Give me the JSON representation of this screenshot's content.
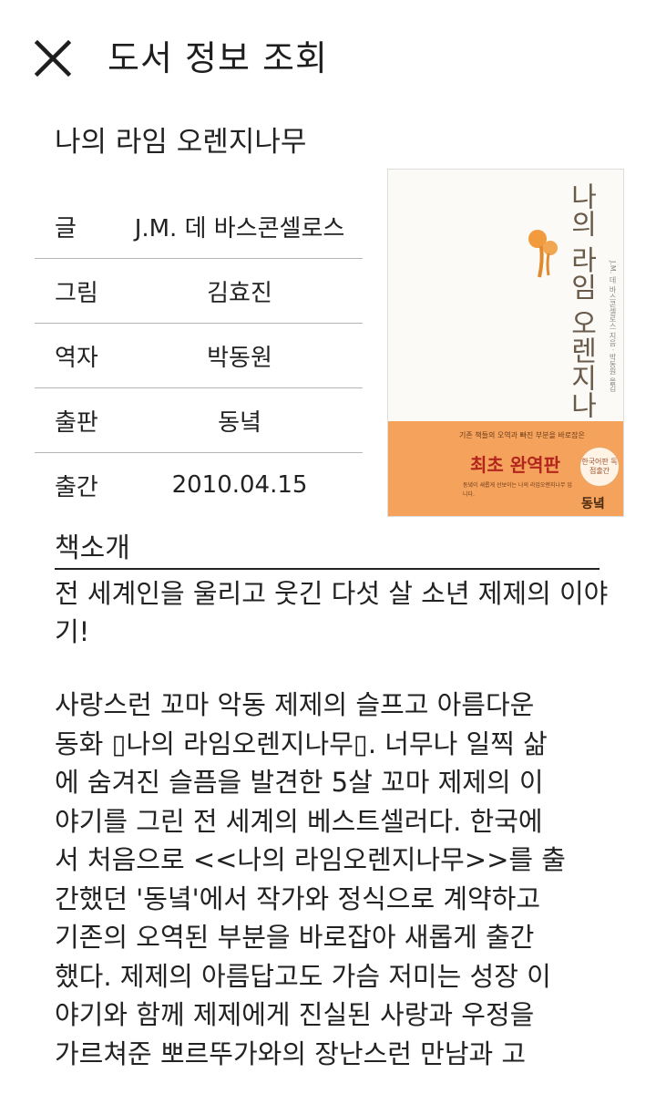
{
  "header": {
    "title": "도서 정보 조회",
    "close_icon": "close-icon"
  },
  "book": {
    "title": "나의 라임 오렌지나무",
    "info": [
      {
        "label": "글",
        "value": "J.M. 데 바스콘셀로스"
      },
      {
        "label": "그림",
        "value": "김효진"
      },
      {
        "label": "역자",
        "value": "박동원"
      },
      {
        "label": "출판",
        "value": "동녘"
      },
      {
        "label": "출간",
        "value": "2010.04.15"
      }
    ],
    "cover": {
      "title": "나의 라임 오렌지나무",
      "subtitle": "J.M. 데 바스콘셀로스 지음 · 박동원 옮김",
      "band_sub": "기존 책들의 오역과 빠진 부분을 바로잡은",
      "band_main": "최초 완역판",
      "band_lines": "동녘이 새롭게 선보이는 나의 라임오렌지나무 입니다.",
      "seal": "한국어판 독점출간",
      "publisher": "동녘"
    }
  },
  "intro": {
    "section_title": "책소개",
    "heading": "전 세계인을 울리고 웃긴 다섯 살 소년 제제의 이야기!",
    "body": "사랑스런 꼬마 악동 제제의 슬프고 아름다운\n동화  ▯나의 라임오렌지나무▯. 너무나 일찍 삶\n에 숨겨진 슬픔을 발견한 5살 꼬마 제제의 이\n야기를 그린 전 세계의 베스트셀러다. 한국에\n서 처음으로 <<나의 라임오렌지나무>>를 출\n간했던 '동녘'에서 작가와 정식으로 계약하고\n기존의 오역된 부분을 바로잡아 새롭게 출간\n했다. 제제의 아름답고도 가슴 저미는 성장 이\n야기와 함께 제제에게 진실된 사랑과 우정을\n가르쳐준 뽀르뚜가와의 장난스런 만남과 고"
  }
}
